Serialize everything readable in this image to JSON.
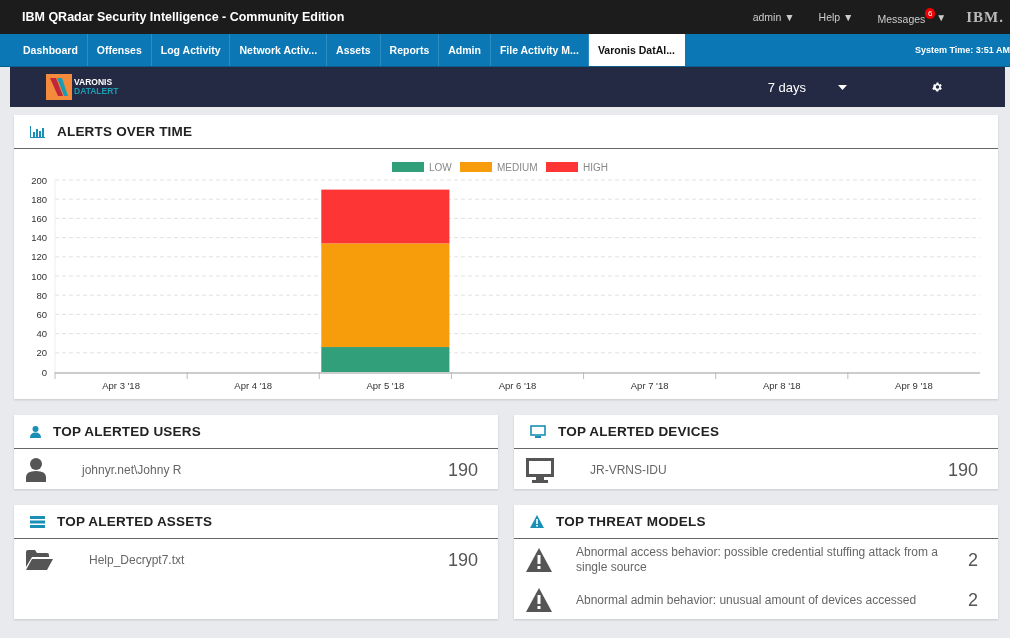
{
  "top_bar": {
    "title": "IBM QRadar Security Intelligence - Community Edition",
    "menus": [
      {
        "label": "admin ▼"
      },
      {
        "label": "Help ▼"
      },
      {
        "label": "Messages",
        "badge": "6",
        "caret": "▼"
      }
    ],
    "logo": "IBM."
  },
  "tabs": [
    {
      "label": "Dashboard",
      "selected": false
    },
    {
      "label": "Offenses",
      "selected": false
    },
    {
      "label": "Log Activity",
      "selected": false
    },
    {
      "label": "Network Activ...",
      "selected": false
    },
    {
      "label": "Assets",
      "selected": false
    },
    {
      "label": "Reports",
      "selected": false
    },
    {
      "label": "Admin",
      "selected": false
    },
    {
      "label": "File Activity M...",
      "selected": false
    },
    {
      "label": "Varonis DatAl...",
      "selected": true
    }
  ],
  "system_time": "System Time: 3:51 AM",
  "app_header": {
    "logo_top": "VARONIS",
    "logo_bottom": "DATALERT",
    "range": "7 days"
  },
  "alerts_over_time": {
    "title": "ALERTS OVER TIME",
    "chart_data": {
      "type": "bar",
      "stacked": true,
      "grid": true,
      "legend": true,
      "categories": [
        "Apr 3 '18",
        "Apr 4 '18",
        "Apr 5 '18",
        "Apr 6 '18",
        "Apr 7 '18",
        "Apr 8 '18",
        "Apr 9 '18"
      ],
      "ylim": [
        0,
        200
      ],
      "yticks": [
        0,
        20,
        40,
        60,
        80,
        100,
        120,
        140,
        160,
        180,
        200
      ],
      "series": [
        {
          "name": "LOW",
          "color": "#31a07a",
          "values": [
            0,
            0,
            26,
            0,
            0,
            0,
            0
          ]
        },
        {
          "name": "MEDIUM",
          "color": "#f79c0a",
          "values": [
            0,
            0,
            108,
            0,
            0,
            0,
            0
          ]
        },
        {
          "name": "HIGH",
          "color": "#fd3535",
          "values": [
            0,
            0,
            56,
            0,
            0,
            0,
            0
          ]
        }
      ]
    }
  },
  "cards": [
    {
      "kind": "users",
      "title": "TOP ALERTED USERS",
      "rows": [
        {
          "label": "johnyr.net\\Johny R",
          "count": "190"
        }
      ]
    },
    {
      "kind": "devices",
      "title": "TOP ALERTED DEVICES",
      "rows": [
        {
          "label": "JR-VRNS-IDU",
          "count": "190"
        }
      ]
    },
    {
      "kind": "assets",
      "title": "TOP ALERTED ASSETS",
      "rows": [
        {
          "label": "Help_Decrypt7.txt",
          "count": "190"
        }
      ]
    },
    {
      "kind": "threats",
      "title": "TOP THREAT MODELS",
      "rows": [
        {
          "label": "Abnormal access behavior: possible credential stuffing attack from a single source",
          "count": "2"
        },
        {
          "label": "Abnormal admin behavior: unusual amount of devices accessed",
          "count": "2"
        }
      ]
    }
  ]
}
